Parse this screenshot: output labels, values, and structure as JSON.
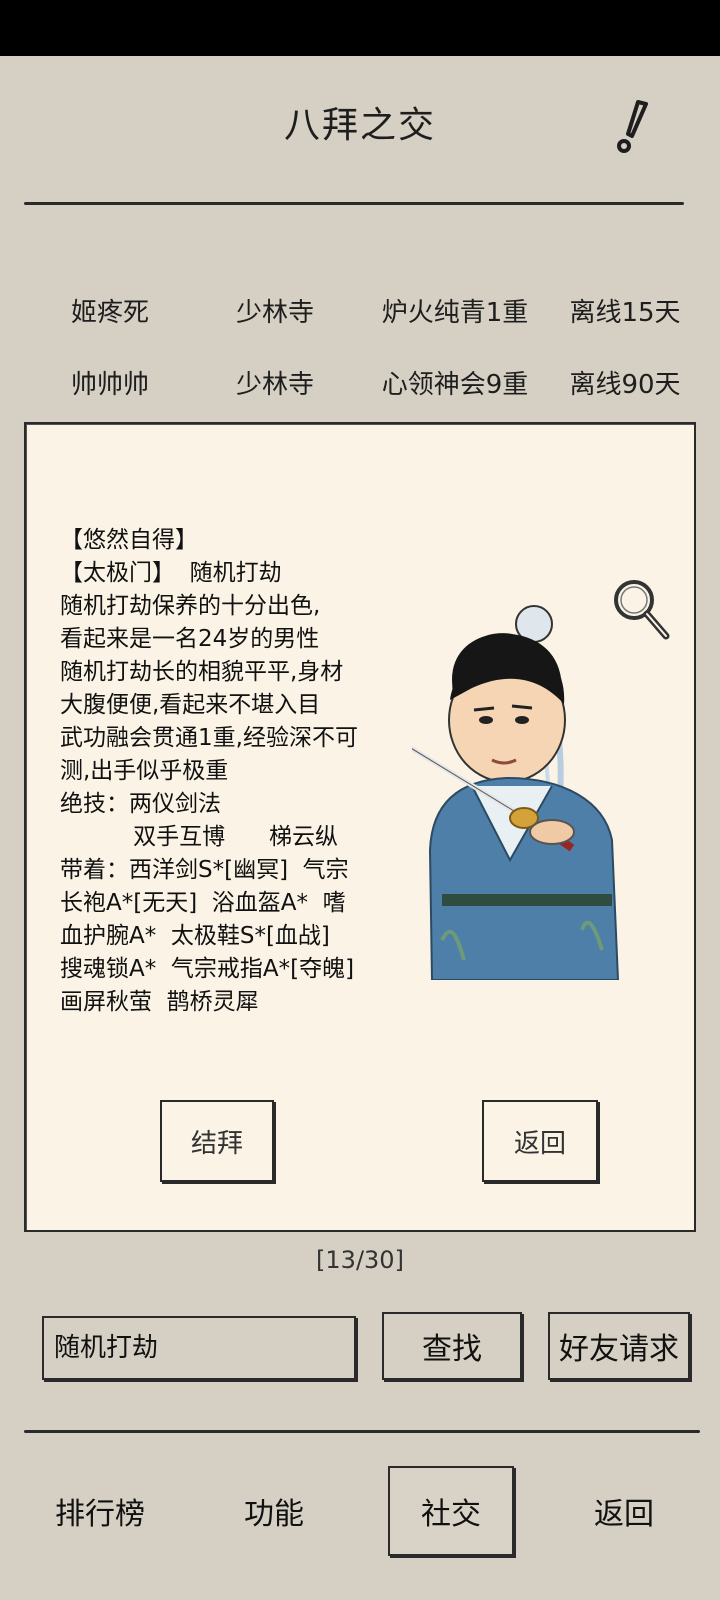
{
  "header": {
    "title": "八拜之交",
    "alert_icon": "exclamation-icon"
  },
  "friends": [
    {
      "name": "姬疼死",
      "sect": "少林寺",
      "skill": "炉火纯青1重",
      "status": "离线15天"
    },
    {
      "name": "帅帅帅",
      "sect": "少林寺",
      "skill": "心领神会9重",
      "status": "离线90天"
    }
  ],
  "profile": {
    "lines": [
      "【悠然自得】",
      "【太极门】  随机打劫",
      "随机打劫保养的十分出色,",
      "看起来是一名24岁的男性",
      "随机打劫长的相貌平平,身材",
      "大腹便便,看起来不堪入目",
      "武功融会贯通1重,经验深不可",
      "测,出手似乎极重",
      "绝技：两仪剑法",
      "          双手互博      梯云纵",
      "带着：西洋剑S*[幽冥]  气宗",
      "长袍A*[无天]  浴血盔A*  嗜",
      "血护腕A*  太极鞋S*[血战]",
      "搜魂锁A*  气宗戒指A*[夺魄]",
      "画屏秋萤  鹊桥灵犀"
    ],
    "magnify_icon": "magnifier-icon",
    "befriend_label": "结拜",
    "back_label": "返回"
  },
  "pager": {
    "counter": "[13/30]"
  },
  "search": {
    "value": "随机打劫",
    "find_label": "查找",
    "request_label": "好友请求"
  },
  "nav": {
    "items": [
      "排行榜",
      "功能",
      "社交",
      "返回"
    ],
    "active": "社交"
  },
  "colors": {
    "background": "#d6d0c4",
    "card": "#fbf4e6",
    "ink": "#2a2a2a",
    "robe": "#4d7fa8"
  }
}
